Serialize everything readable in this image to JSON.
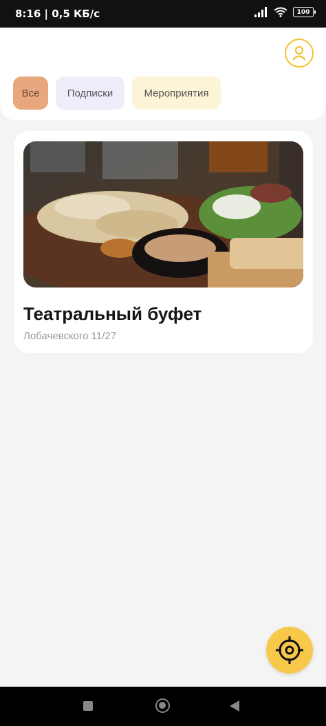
{
  "status_bar": {
    "time": "8:16 | 0,5 КБ/с",
    "battery": "100"
  },
  "filters": {
    "all_label": "Все",
    "subscriptions_label": "Подписки",
    "events_label": "Мероприятия"
  },
  "venue": {
    "title": "Театральный буфет",
    "address": "Лобачевского 11/27"
  },
  "colors": {
    "accent": "#f8c84a",
    "chip_all": "#e8a77c",
    "chip_subscriptions": "#efedfa",
    "chip_events": "#fdf3d6"
  },
  "icons": {
    "profile": "user-icon",
    "locate": "crosshair-icon"
  }
}
